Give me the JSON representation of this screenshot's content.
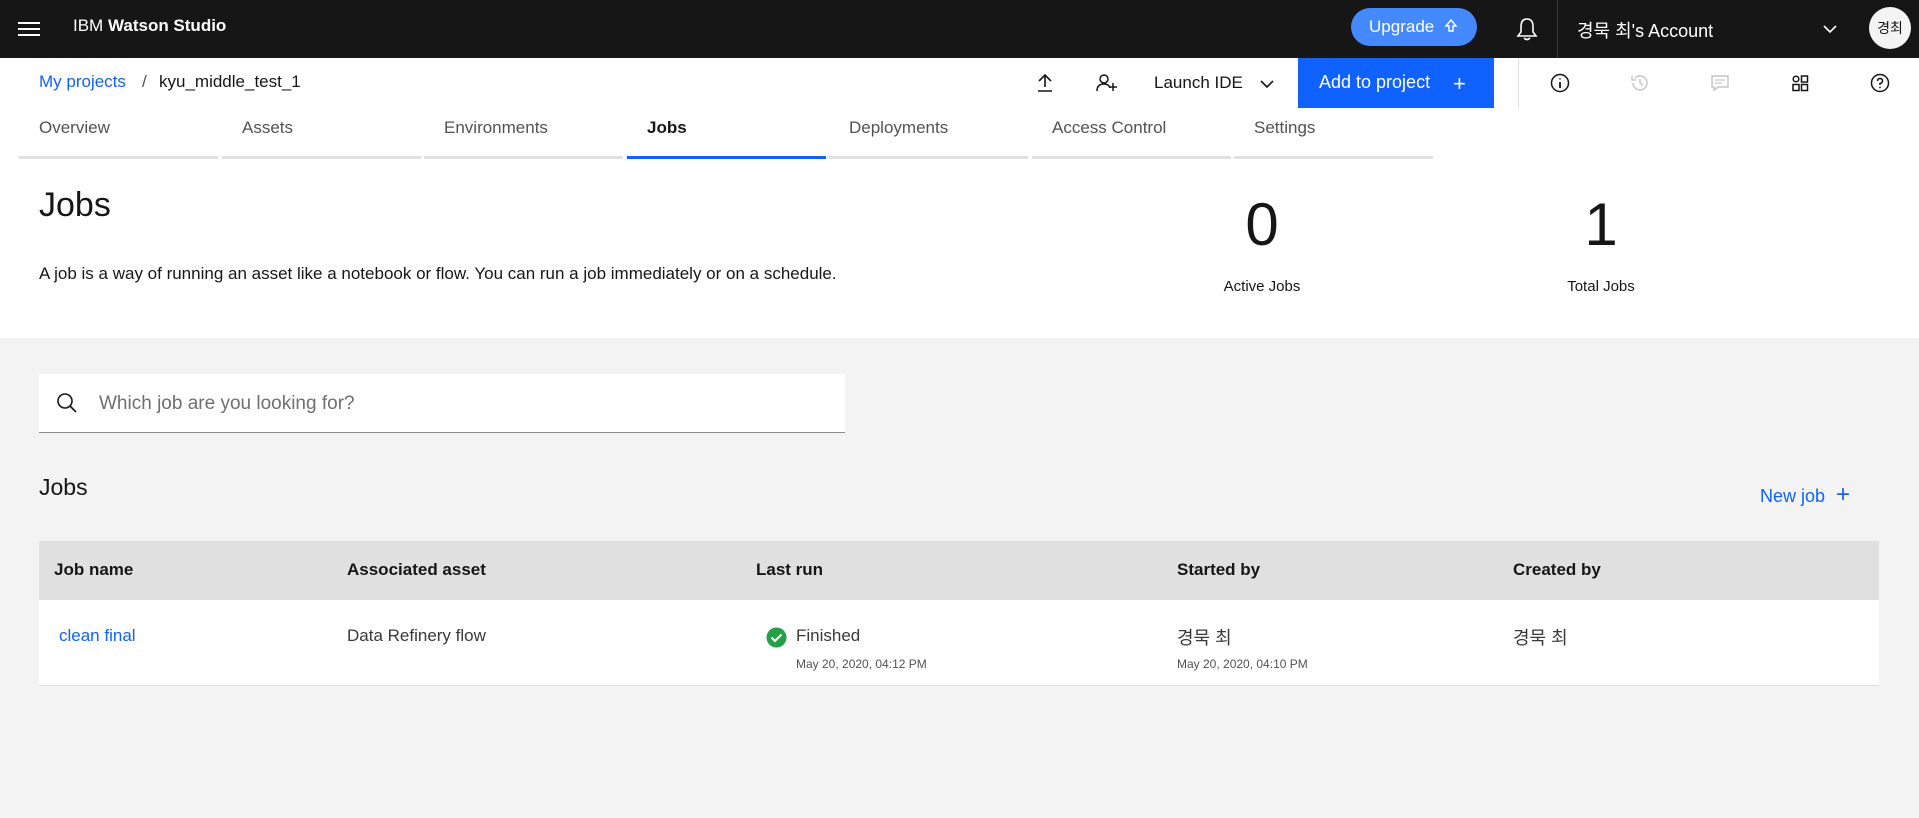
{
  "topbar": {
    "brand_light": "IBM ",
    "brand_bold": "Watson Studio",
    "upgrade_label": "Upgrade",
    "account_label": "경묵 최's Account",
    "avatar_initials": "경최"
  },
  "breadcrumb": {
    "parent": "My projects",
    "separator": "/",
    "current": "kyu_middle_test_1"
  },
  "header": {
    "launch_ide_label": "Launch IDE",
    "add_to_project_label": "Add to project",
    "add_to_project_icon": "+"
  },
  "tabs": [
    {
      "label": "Overview"
    },
    {
      "label": "Assets"
    },
    {
      "label": "Environments"
    },
    {
      "label": "Jobs",
      "active": true
    },
    {
      "label": "Deployments"
    },
    {
      "label": "Access Control"
    },
    {
      "label": "Settings"
    }
  ],
  "summary": {
    "title": "Jobs",
    "description": "A job is a way of running an asset like a notebook or flow. You can run a job immediately or on a schedule.",
    "active_jobs_value": "0",
    "active_jobs_label": "Active Jobs",
    "total_jobs_value": "1",
    "total_jobs_label": "Total Jobs"
  },
  "search": {
    "placeholder": "Which job are you looking for?"
  },
  "jobs_list": {
    "title": "Jobs",
    "new_job_label": "New job",
    "new_job_icon": "+",
    "columns": [
      "Job name",
      "Associated asset",
      "Last run",
      "Started by",
      "Created by"
    ],
    "rows": [
      {
        "job_name": "clean final",
        "associated_asset": "Data Refinery flow",
        "last_run_status": "Finished",
        "last_run_time": "May 20, 2020, 04:12 PM",
        "started_by": "경묵 최",
        "started_time": "May 20, 2020, 04:10 PM",
        "created_by": "경묵 최"
      }
    ]
  },
  "colors": {
    "topbar_bg": "#161616",
    "accent": "#0f62fe",
    "upgrade": "#4589ff",
    "success": "#24a148"
  }
}
